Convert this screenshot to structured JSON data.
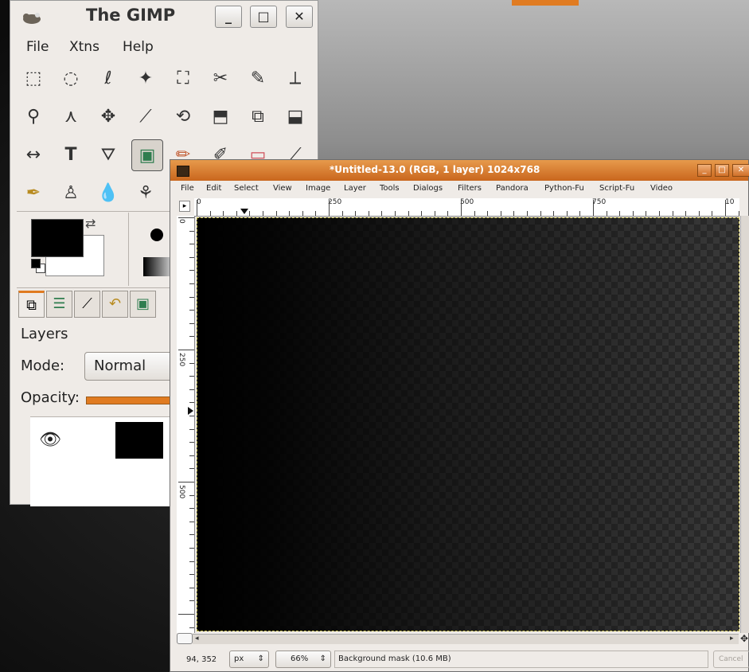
{
  "toolbox": {
    "title": "The GIMP",
    "menus": [
      "File",
      "Xtns",
      "Help"
    ],
    "tools": [
      [
        "⬚",
        "◌",
        "ℓ",
        "✦",
        "⛶",
        "✂",
        "✎",
        "⟂"
      ],
      [
        "⚲",
        "⋏",
        "✥",
        "⟋",
        "⟲",
        "⬒",
        "⧉",
        "⬓"
      ],
      [
        "↔",
        "T",
        "⛛",
        "▣",
        "✏",
        "✐",
        "▭",
        "⟋"
      ],
      [
        "✒",
        "♙",
        "💧",
        "⚘"
      ]
    ],
    "active_tool": "blend-tool",
    "layers_label": "Layers",
    "mode_label": "Mode:",
    "mode_value": "Normal",
    "opacity_label": "Opacity:",
    "opacity_value": 1.0
  },
  "image_window": {
    "title": "*Untitled-13.0 (RGB, 1 layer) 1024x768",
    "menus": [
      "File",
      "Edit",
      "Select",
      "View",
      "Image",
      "Layer",
      "Tools",
      "Dialogs",
      "Filters",
      "Pandora",
      "Python-Fu",
      "Script-Fu",
      "Video"
    ],
    "hruler_labels": [
      "0",
      "250",
      "500",
      "750",
      "10"
    ],
    "vruler_labels": [
      "0",
      "250",
      "500"
    ],
    "status": {
      "coords": "94, 352",
      "unit": "px",
      "zoom": "66%",
      "message": "Background mask (10.6 MB)",
      "cancel": "Cancel"
    }
  },
  "colors": {
    "accent": "#e07b21",
    "titlebar_start": "#e79a4c",
    "titlebar_end": "#c9661d",
    "panel_bg": "#efebe7"
  }
}
